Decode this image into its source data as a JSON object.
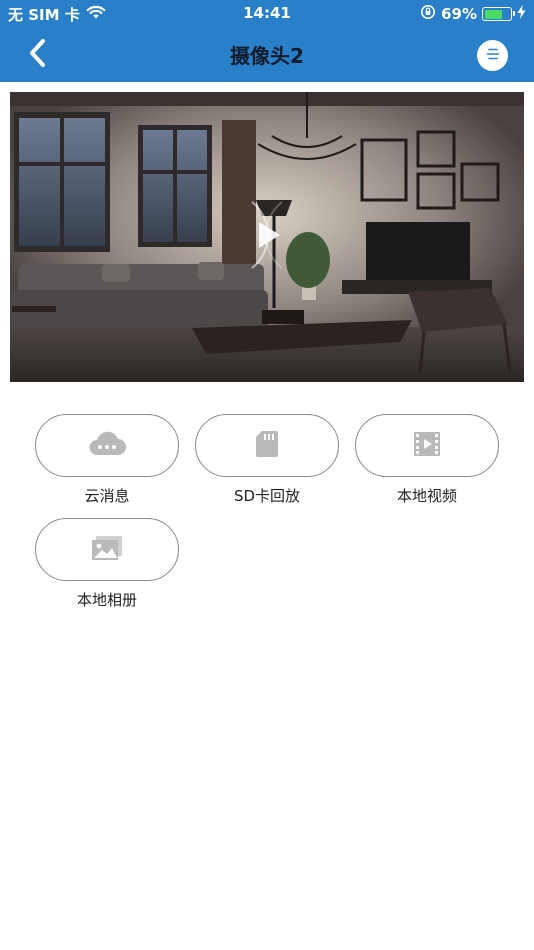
{
  "status_bar": {
    "carrier": "无 SIM 卡",
    "time": "14:41",
    "battery_percent": "69%",
    "battery_level": 0.69
  },
  "nav": {
    "title": "摄像头2"
  },
  "features": [
    {
      "label": "云消息",
      "icon": "cloud-icon"
    },
    {
      "label": "SD卡回放",
      "icon": "sd-card-icon"
    },
    {
      "label": "本地视频",
      "icon": "video-file-icon"
    },
    {
      "label": "本地相册",
      "icon": "photo-album-icon"
    }
  ],
  "colors": {
    "header": "#2a7fc9",
    "battery_fill": "#4cd964",
    "icon_gray": "#b9b9b9"
  }
}
